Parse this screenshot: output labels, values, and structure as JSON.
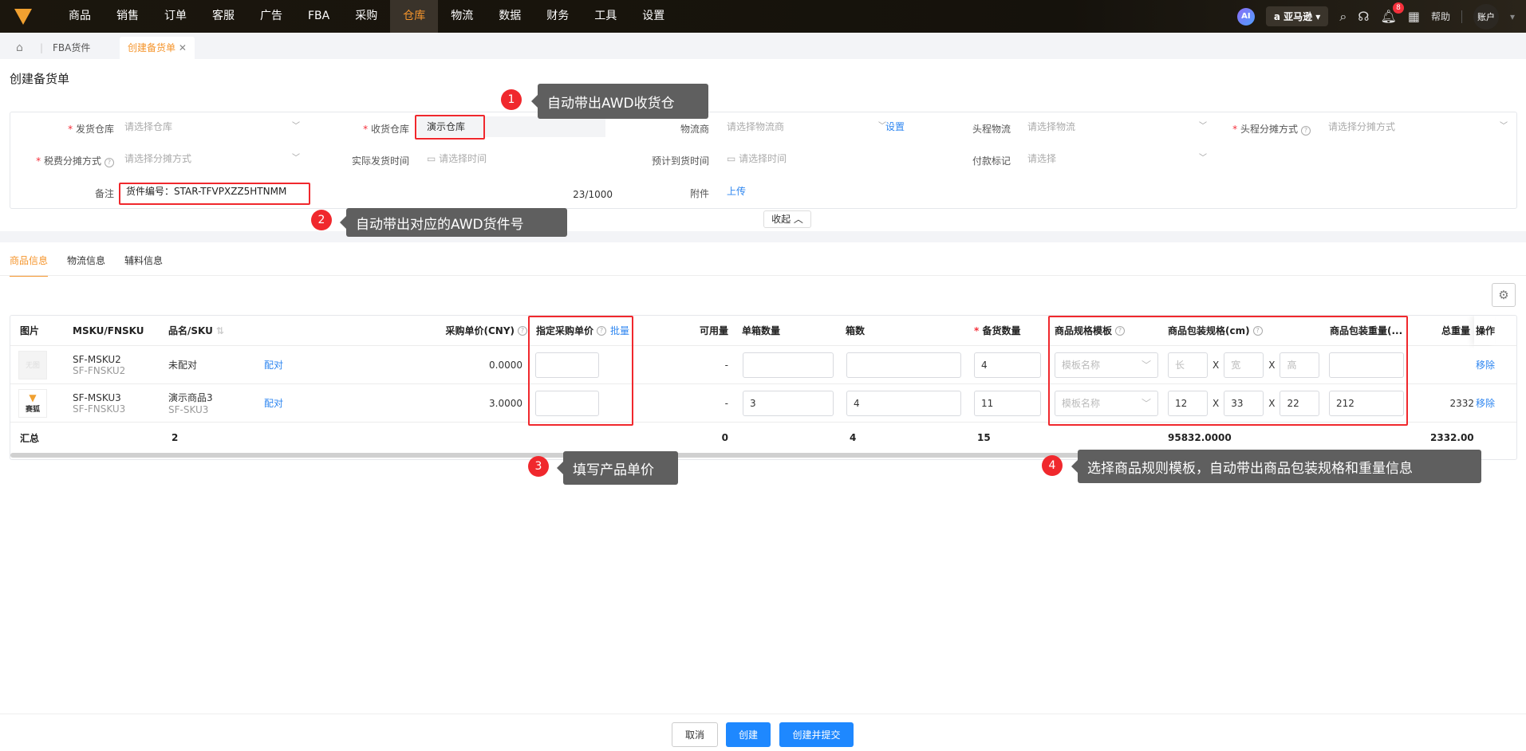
{
  "nav": {
    "items": [
      "商品",
      "销售",
      "订单",
      "客服",
      "广告",
      "FBA",
      "采购",
      "仓库",
      "物流",
      "数据",
      "财务",
      "工具",
      "设置"
    ],
    "active": "仓库",
    "ai": "AI",
    "platform": "亚马逊",
    "notifications": "8",
    "help": "帮助",
    "account": "账户"
  },
  "tabs": {
    "t1": "FBA货件",
    "t2": "创建备货单"
  },
  "page_title": "创建备货单",
  "form": {
    "ship_wh_label": "发货仓库",
    "ship_wh_ph": "请选择仓库",
    "recv_wh_label": "收货仓库",
    "recv_wh_value": "演示仓库",
    "carrier_label": "物流商",
    "carrier_ph": "请选择物流商",
    "carrier_settings": "设置",
    "first_leg_label": "头程物流",
    "first_leg_ph": "请选择物流",
    "alloc_label": "头程分摊方式",
    "alloc_ph": "请选择分摊方式",
    "tax_label": "税费分摊方式",
    "tax_ph": "请选择分摊方式",
    "ship_time_label": "实际发货时间",
    "ship_time_ph": "请选择时间",
    "eta_label": "预计到货时间",
    "eta_ph": "请选择时间",
    "pay_label": "付款标记",
    "pay_ph": "请选择",
    "note_label": "备注",
    "note_value": "货件编号：STAR-TFVPXZZ5HTNMM",
    "note_count": "23/1000",
    "attach_label": "附件",
    "attach_upload": "上传",
    "collapse": "收起"
  },
  "section_tabs": [
    "商品信息",
    "物流信息",
    "辅料信息"
  ],
  "table": {
    "headers": {
      "img": "图片",
      "msku": "MSKU/FNSKU",
      "name": "品名/SKU",
      "price": "采购单价(CNY)",
      "assigned": "指定采购单价",
      "batch": "批量",
      "avail": "可用量",
      "per_box": "单箱数量",
      "boxes": "箱数",
      "qty": "备货数量",
      "tmpl": "商品规格模板",
      "dims": "商品包装规格(cm)",
      "weight": "商品包装重量(...",
      "total_weight": "总重量",
      "ops": "操作"
    },
    "rows": [
      {
        "thumb": "无图",
        "msku": "SF-MSKU2",
        "fnsku": "SF-FNSKU2",
        "name": "未配对",
        "sku": "",
        "pair": "配对",
        "price": "0.0000",
        "assigned": "",
        "avail": "-",
        "per_box": "",
        "boxes": "",
        "qty": "4",
        "tmpl_ph": "模板名称",
        "l": "",
        "w": "",
        "h": "",
        "l_ph": "长",
        "w_ph": "宽",
        "h_ph": "高",
        "weight": "",
        "total_weight": "",
        "remove": "移除"
      },
      {
        "thumb": "赛狐",
        "msku": "SF-MSKU3",
        "fnsku": "SF-FNSKU3",
        "name": "演示商品3",
        "sku": "SF-SKU3",
        "pair": "配对",
        "price": "3.0000",
        "assigned": "",
        "avail": "-",
        "per_box": "3",
        "boxes": "4",
        "qty": "11",
        "tmpl_ph": "模板名称",
        "l": "12",
        "w": "33",
        "h": "22",
        "weight": "212",
        "total_weight": "2332",
        "remove": "移除"
      }
    ],
    "summary": {
      "label": "汇总",
      "count": "2",
      "avail": "0",
      "boxes": "4",
      "qty": "15",
      "dims_total": "95832.0000",
      "total_weight": "2332.00"
    }
  },
  "annotations": [
    {
      "n": "1",
      "text": "自动带出AWD收货仓"
    },
    {
      "n": "2",
      "text": "自动带出对应的AWD货件号"
    },
    {
      "n": "3",
      "text": "填写产品单价"
    },
    {
      "n": "4",
      "text": "选择商品规则模板，自动带出商品包装规格和重量信息"
    }
  ],
  "footer": {
    "cancel": "取消",
    "create": "创建",
    "create_submit": "创建并提交"
  },
  "colors": {
    "accent": "#f5952c",
    "primary": "#1e88ff",
    "annotation_red": "#f0282d"
  }
}
